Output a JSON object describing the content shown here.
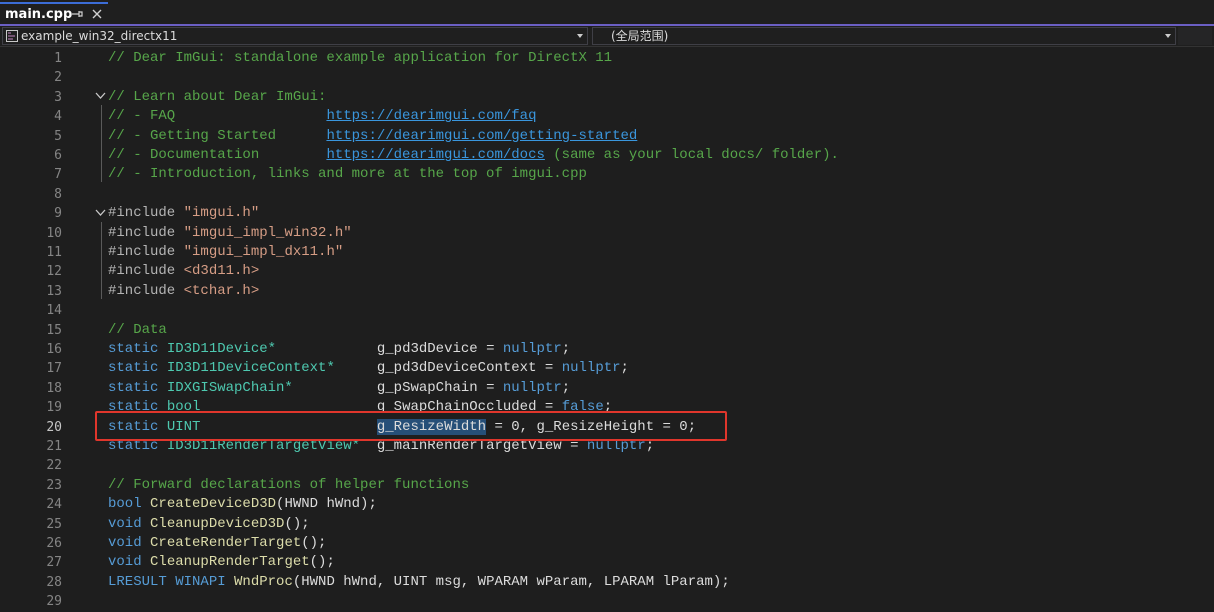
{
  "tab": {
    "title": "main.cpp",
    "pin_icon": "pin-icon",
    "close_icon": "close-icon"
  },
  "navbar": {
    "project": "example_win32_directx11",
    "scope": "(全局范围)"
  },
  "colors": {
    "background": "#1e1e1e",
    "comment": "#57a64a",
    "keyword": "#569cd6",
    "type": "#4ec9b0",
    "string": "#d69d85",
    "link": "#3a96dd",
    "selection": "#264f78",
    "highlight_box": "#e0362c",
    "tab_accent": "#6b5fc4"
  },
  "editor": {
    "active_line": 20,
    "selected_text": "g_ResizeWidth",
    "lines": [
      {
        "n": "1",
        "t": "// Dear ImGui: standalone example application for DirectX 11"
      },
      {
        "n": "2",
        "t": ""
      },
      {
        "n": "3",
        "t": "// Learn about Dear ImGui:"
      },
      {
        "n": "4",
        "a": "// - FAQ                  ",
        "u": "https://dearimgui.com/faq",
        "b": ""
      },
      {
        "n": "5",
        "a": "// - Getting Started      ",
        "u": "https://dearimgui.com/getting-started",
        "b": ""
      },
      {
        "n": "6",
        "a": "// - Documentation        ",
        "u": "https://dearimgui.com/docs",
        "b": " (same as your local docs/ folder)."
      },
      {
        "n": "7",
        "t": "// - Introduction, links and more at the top of imgui.cpp"
      },
      {
        "n": "8",
        "t": ""
      },
      {
        "n": "9",
        "k": "#include ",
        "s": "\"imgui.h\""
      },
      {
        "n": "10",
        "k": "#include ",
        "s": "\"imgui_impl_win32.h\""
      },
      {
        "n": "11",
        "k": "#include ",
        "s": "\"imgui_impl_dx11.h\""
      },
      {
        "n": "12",
        "k": "#include ",
        "s": "<d3d11.h>"
      },
      {
        "n": "13",
        "k": "#include ",
        "s": "<tchar.h>"
      },
      {
        "n": "14",
        "t": ""
      },
      {
        "n": "15",
        "t": "// Data"
      },
      {
        "n": "16",
        "kw": "static ",
        "ty": "ID3D11Device*",
        "pad": "            ",
        "v": "g_pd3dDevice",
        "eq": " = ",
        "val": "nullptr",
        "end": ";"
      },
      {
        "n": "17",
        "kw": "static ",
        "ty": "ID3D11DeviceContext*",
        "pad": "     ",
        "v": "g_pd3dDeviceContext",
        "eq": " = ",
        "val": "nullptr",
        "end": ";"
      },
      {
        "n": "18",
        "kw": "static ",
        "ty": "IDXGISwapChain*",
        "pad": "          ",
        "v": "g_pSwapChain",
        "eq": " = ",
        "val": "nullptr",
        "end": ";"
      },
      {
        "n": "19",
        "kw": "static ",
        "ty": "bool",
        "pad": "                     ",
        "v": "g_SwapChainOccluded",
        "eq": " = ",
        "val": "false",
        "end": ";"
      },
      {
        "n": "20",
        "kw": "static ",
        "ty": "UINT",
        "pad": "                     ",
        "v": "g_ResizeWidth",
        "rest": " = 0, g_ResizeHeight = 0;"
      },
      {
        "n": "21",
        "kw": "static ",
        "ty": "ID3D11RenderTargetView*",
        "pad": "  ",
        "v": "g_mainRenderTargetView",
        "eq": " = ",
        "val": "nullptr",
        "end": ";"
      },
      {
        "n": "22",
        "t": ""
      },
      {
        "n": "23",
        "t": "// Forward declarations of helper functions"
      },
      {
        "n": "24",
        "rt": "bool ",
        "fn": "CreateDeviceD3D",
        "args": "(HWND hWnd);"
      },
      {
        "n": "25",
        "rt": "void ",
        "fn": "CleanupDeviceD3D",
        "args": "();"
      },
      {
        "n": "26",
        "rt": "void ",
        "fn": "CreateRenderTarget",
        "args": "();"
      },
      {
        "n": "27",
        "rt": "void ",
        "fn": "CleanupRenderTarget",
        "args": "();"
      },
      {
        "n": "28",
        "rt": "LRESULT WINAPI ",
        "fn": "WndProc",
        "args": "(HWND hWnd, UINT msg, WPARAM wParam, LPARAM lParam);"
      },
      {
        "n": "29",
        "t": ""
      }
    ]
  }
}
